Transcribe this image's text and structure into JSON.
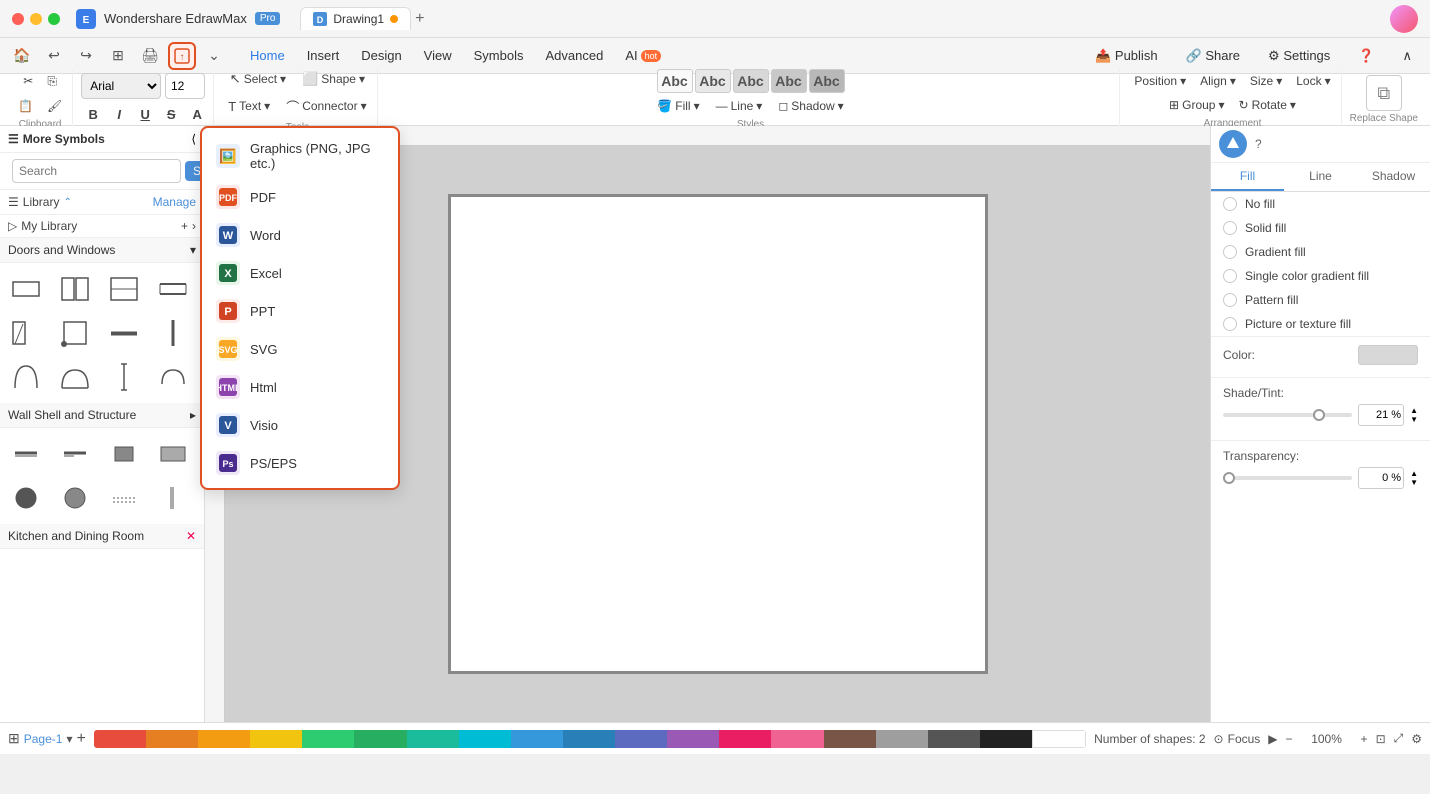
{
  "titleBar": {
    "appName": "Wondershare EdrawMax",
    "badge": "Pro",
    "tabName": "Drawing1",
    "tabDot": true,
    "addTab": "+"
  },
  "menuBar": {
    "items": [
      "Home",
      "Insert",
      "Design",
      "View",
      "Symbols",
      "Advanced",
      "AI"
    ],
    "aiHot": true,
    "icons": [
      "home",
      "undo",
      "redo",
      "view",
      "export",
      "more"
    ]
  },
  "toolbar": {
    "fontName": "Arial",
    "boldLabel": "B",
    "italicLabel": "I",
    "underlineLabel": "U",
    "strikeLabel": "S",
    "selectLabel": "Select",
    "shapeLabel": "Shape",
    "textLabel": "Text",
    "connectorLabel": "Connector",
    "fillLabel": "Fill",
    "lineLabel": "Line",
    "shadowLabel": "Shadow",
    "positionLabel": "Position",
    "alignLabel": "Align",
    "sizeLabel": "Size",
    "lockLabel": "Lock",
    "groupLabel": "Group",
    "rotateLabel": "Rotate",
    "replaceShapeLabel": "Replace Shape"
  },
  "leftPanel": {
    "title": "More Symbols",
    "searchPlaceholder": "Search",
    "searchButton": "Search",
    "libraryLabel": "Library",
    "manageLabel": "Manage",
    "myLibraryLabel": "My Library",
    "sections": [
      {
        "label": "Doors and Windows",
        "expanded": true
      },
      {
        "label": "Wall Shell and Structure",
        "expanded": false
      },
      {
        "label": "Kitchen and Dining Room",
        "expanded": false
      }
    ]
  },
  "dropdown": {
    "items": [
      {
        "label": "Graphics (PNG, JPG etc.)",
        "icon": "🖼️",
        "color": "#4a90d9"
      },
      {
        "label": "PDF",
        "icon": "📄",
        "color": "#e05020"
      },
      {
        "label": "Word",
        "icon": "W",
        "color": "#2b579a"
      },
      {
        "label": "Excel",
        "icon": "X",
        "color": "#217346"
      },
      {
        "label": "PPT",
        "icon": "P",
        "color": "#d04423"
      },
      {
        "label": "SVG",
        "icon": "S",
        "color": "#f9a825"
      },
      {
        "label": "Html",
        "icon": "H",
        "color": "#8e44ad"
      },
      {
        "label": "Visio",
        "icon": "V",
        "color": "#2b579a"
      },
      {
        "label": "PS/EPS",
        "icon": "Ps",
        "color": "#4a2b8e"
      }
    ]
  },
  "rightPanel": {
    "tabs": [
      "Fill",
      "Line",
      "Shadow"
    ],
    "activeTab": "Fill",
    "fillOptions": [
      {
        "label": "No fill",
        "selected": false
      },
      {
        "label": "Solid fill",
        "selected": false
      },
      {
        "label": "Gradient fill",
        "selected": false
      },
      {
        "label": "Single color gradient fill",
        "selected": false
      },
      {
        "label": "Pattern fill",
        "selected": false
      },
      {
        "label": "Picture or texture fill",
        "selected": false
      }
    ],
    "colorLabel": "Color:",
    "shadeTintLabel": "Shade/Tint:",
    "shadeTintValue": "21 %",
    "transparencyLabel": "Transparency:",
    "transparencyValue": "0 %"
  },
  "bottomBar": {
    "pageLabel": "Page-1",
    "shapesCount": "Number of shapes: 2",
    "focusLabel": "Focus",
    "zoomLevel": "100%",
    "addPage": "+"
  },
  "colors": {
    "accent": "#4a90d9",
    "highlight": "#e05020"
  }
}
